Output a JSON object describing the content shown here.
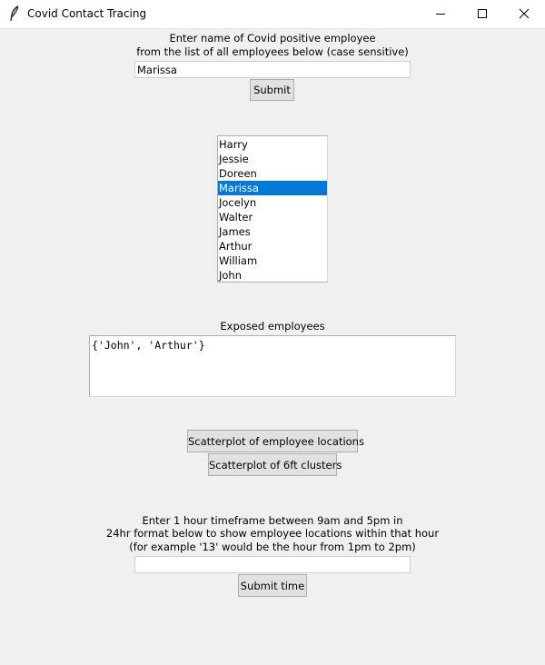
{
  "window": {
    "title": "Covid Contact Tracing"
  },
  "employee_prompt": {
    "line1": "Enter name of Covid positive employee",
    "line2": "from the list of all employees below (case sensitive)"
  },
  "employee_input": {
    "value": "Marissa"
  },
  "submit_button": {
    "label": "Submit"
  },
  "employee_list": {
    "items": [
      "Harry",
      "Jessie",
      "Doreen",
      "Marissa",
      "Jocelyn",
      "Walter",
      "James",
      "Arthur",
      "William",
      "John"
    ],
    "selected": "Marissa"
  },
  "exposed": {
    "label": "Exposed employees",
    "value": "{'John', 'Arthur'}"
  },
  "scatter_buttons": {
    "locations_label": "Scatterplot of employee locations",
    "clusters_label": "Scatterplot of 6ft clusters"
  },
  "time_prompt": {
    "line1": "Enter 1 hour timeframe between 9am and 5pm in",
    "line2": "24hr format below to show employee locations within that hour",
    "line3": "(for example '13' would be the hour from 1pm to 2pm)"
  },
  "time_input": {
    "value": ""
  },
  "submit_time_button": {
    "label": "Submit time"
  },
  "colors": {
    "selection": "#0078d7",
    "window_background": "#f0f0f0"
  },
  "icons": {
    "app": "feather-icon",
    "minimize": "minimize-icon",
    "maximize": "maximize-icon",
    "close": "close-icon"
  }
}
